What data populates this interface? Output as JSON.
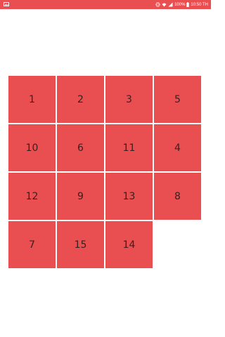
{
  "status_bar": {
    "battery_text": "100%",
    "time": "10:50 TH",
    "color": "#e94f51",
    "icons": [
      "image-icon",
      "vibrate-icon",
      "wifi-icon",
      "signal-icon",
      "battery-icon"
    ]
  },
  "board": {
    "tile_color": "#e94f51",
    "tiles": [
      "1",
      "2",
      "3",
      "5",
      "10",
      "6",
      "11",
      "4",
      "12",
      "9",
      "13",
      "8",
      "7",
      "15",
      "14",
      ""
    ]
  }
}
